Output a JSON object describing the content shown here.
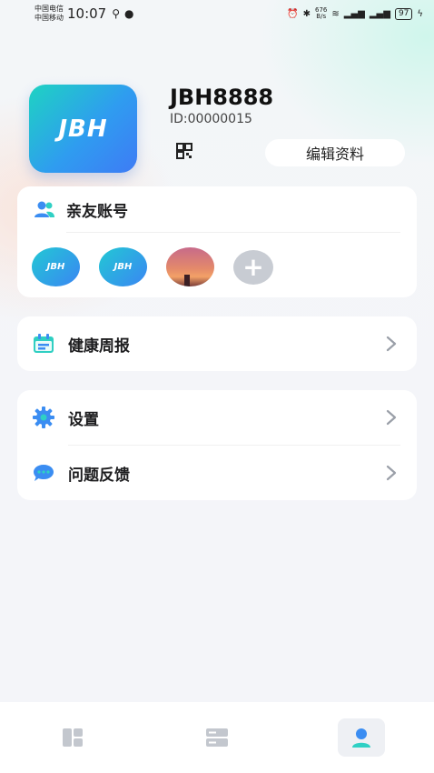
{
  "status_bar": {
    "carrier_1": "中国电信",
    "carrier_2": "中国移动",
    "time": "10:07",
    "net_speed_value": "676",
    "net_speed_unit": "B/s",
    "battery": "97"
  },
  "profile": {
    "avatar_text": "JBH",
    "username": "JBH8888",
    "user_id": "ID:00000015",
    "edit_label": "编辑资料"
  },
  "friends": {
    "title": "亲友账号",
    "members": [
      {
        "type": "logo",
        "text": "JBH"
      },
      {
        "type": "logo",
        "text": "JBH"
      },
      {
        "type": "photo",
        "text": ""
      }
    ]
  },
  "menu": {
    "health_report": "健康周报",
    "settings": "设置",
    "feedback": "问题反馈"
  },
  "tab_bar": {
    "tabs": [
      {
        "icon": "dashboard-icon",
        "active": false
      },
      {
        "icon": "list-icon",
        "active": false
      },
      {
        "icon": "profile-icon",
        "active": true
      }
    ]
  },
  "colors": {
    "accent": "#2f9cf0",
    "accent_teal": "#1ed3c2",
    "background": "#f4f5f9"
  }
}
